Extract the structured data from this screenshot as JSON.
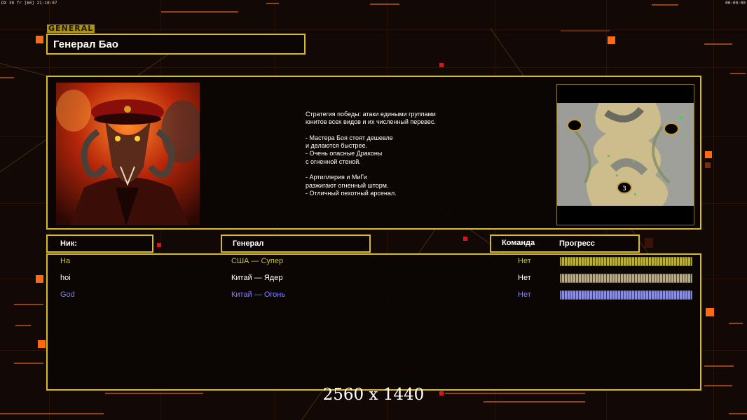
{
  "hud": {
    "left_status": "DX 30 fr [60] 21:10:07",
    "right_clock": "00:00:00"
  },
  "general": {
    "tag": "GENERAL",
    "name": "Генерал Бао"
  },
  "description": [
    "Стратегия победы: атаки едиными группами",
    "юнитов всех видов и их численный перевес.",
    "",
    "- Мастера Боя стоят дешевле",
    "и делаются быстрее.",
    "- Очень опасные Драконы",
    "с огненной стеной.",
    "",
    "- Артиллерия и МиГи",
    "разжигают огненный шторм.",
    "- Отличный пехотный арсенал."
  ],
  "minimap": {
    "start_marker": "3",
    "icon": "map-preview"
  },
  "headers": {
    "nick": "Ник:",
    "general": "Генерал",
    "team": "Команда",
    "progress": "Прогресс"
  },
  "players": [
    {
      "nick": "Ha",
      "general": "США — Супер",
      "team": "Нет",
      "progress": 1.0,
      "color": "#c8c23a",
      "bar_color": "#b9b13a"
    },
    {
      "nick": "hoi",
      "general": "Китай — Ядер",
      "team": "Нет",
      "progress": 1.0,
      "color": "#ffffff",
      "bar_color": "#b8ac8c"
    },
    {
      "nick": "God",
      "general": "Китай — Огонь",
      "team": "Нет",
      "progress": 1.0,
      "color": "#8080ff",
      "bar_color": "#8c8ce0"
    }
  ],
  "resolution_text": "2560 x 1440",
  "colors": {
    "frame": "#d8bb1e",
    "accent": "#ff6a10",
    "background": "#120906"
  }
}
